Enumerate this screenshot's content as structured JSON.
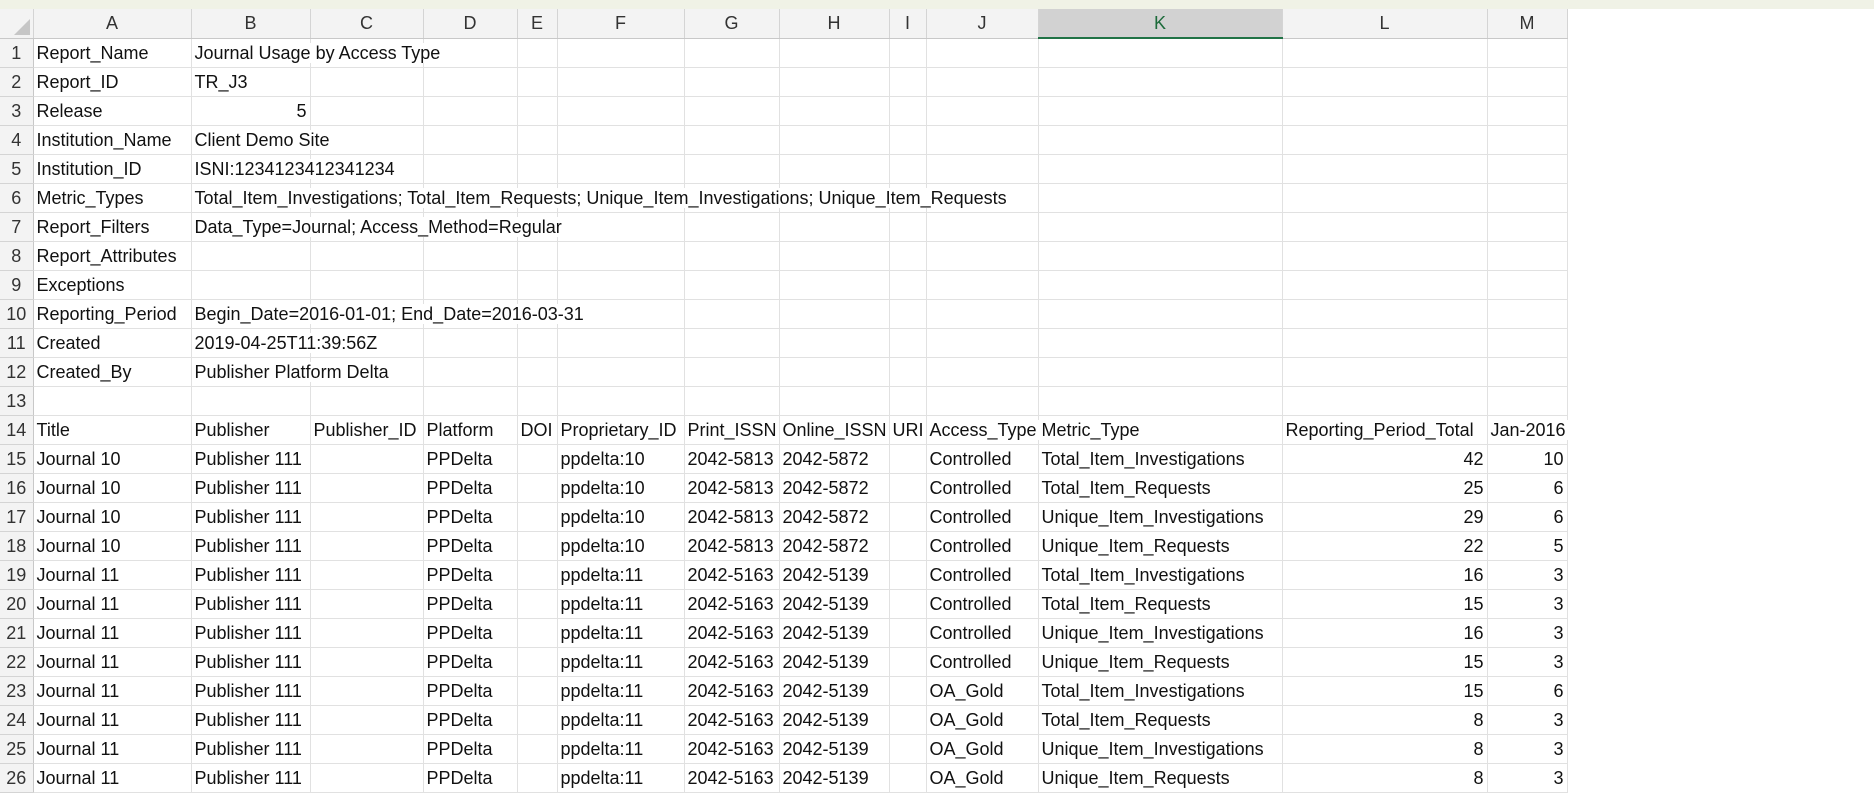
{
  "columns": [
    "A",
    "B",
    "C",
    "D",
    "E",
    "F",
    "G",
    "H",
    "I",
    "J",
    "K",
    "L",
    "M"
  ],
  "selected_column": "K",
  "rows": [
    {
      "num": "1",
      "cells": [
        "Report_Name",
        "Journal Usage by Access Type",
        "",
        "",
        "",
        "",
        "",
        "",
        "",
        "",
        "",
        "",
        ""
      ]
    },
    {
      "num": "2",
      "cells": [
        "Report_ID",
        "TR_J3",
        "",
        "",
        "",
        "",
        "",
        "",
        "",
        "",
        "",
        "",
        ""
      ]
    },
    {
      "num": "3",
      "cells": [
        "Release",
        "5",
        "",
        "",
        "",
        "",
        "",
        "",
        "",
        "",
        "",
        "",
        ""
      ]
    },
    {
      "num": "4",
      "cells": [
        "Institution_Name",
        "Client Demo Site",
        "",
        "",
        "",
        "",
        "",
        "",
        "",
        "",
        "",
        "",
        ""
      ]
    },
    {
      "num": "5",
      "cells": [
        "Institution_ID",
        "ISNI:1234123412341234",
        "",
        "",
        "",
        "",
        "",
        "",
        "",
        "",
        "",
        "",
        ""
      ]
    },
    {
      "num": "6",
      "cells": [
        "Metric_Types",
        "Total_Item_Investigations; Total_Item_Requests; Unique_Item_Investigations; Unique_Item_Requests",
        "",
        "",
        "",
        "",
        "",
        "",
        "",
        "",
        "",
        "",
        ""
      ]
    },
    {
      "num": "7",
      "cells": [
        "Report_Filters",
        "Data_Type=Journal; Access_Method=Regular",
        "",
        "",
        "",
        "",
        "",
        "",
        "",
        "",
        "",
        "",
        ""
      ]
    },
    {
      "num": "8",
      "cells": [
        "Report_Attributes",
        "",
        "",
        "",
        "",
        "",
        "",
        "",
        "",
        "",
        "",
        "",
        ""
      ]
    },
    {
      "num": "9",
      "cells": [
        "Exceptions",
        "",
        "",
        "",
        "",
        "",
        "",
        "",
        "",
        "",
        "",
        "",
        ""
      ]
    },
    {
      "num": "10",
      "cells": [
        "Reporting_Period",
        "Begin_Date=2016-01-01; End_Date=2016-03-31",
        "",
        "",
        "",
        "",
        "",
        "",
        "",
        "",
        "",
        "",
        ""
      ]
    },
    {
      "num": "11",
      "cells": [
        "Created",
        "2019-04-25T11:39:56Z",
        "",
        "",
        "",
        "",
        "",
        "",
        "",
        "",
        "",
        "",
        ""
      ]
    },
    {
      "num": "12",
      "cells": [
        "Created_By",
        "Publisher Platform Delta",
        "",
        "",
        "",
        "",
        "",
        "",
        "",
        "",
        "",
        "",
        ""
      ]
    },
    {
      "num": "13",
      "cells": [
        "",
        "",
        "",
        "",
        "",
        "",
        "",
        "",
        "",
        "",
        "",
        "",
        ""
      ]
    },
    {
      "num": "14",
      "cells": [
        "Title",
        "Publisher",
        "Publisher_ID",
        "Platform",
        "DOI",
        "Proprietary_ID",
        "Print_ISSN",
        "Online_ISSN",
        "URI",
        "Access_Type",
        "Metric_Type",
        "Reporting_Period_Total",
        "Jan-2016"
      ]
    },
    {
      "num": "15",
      "cells": [
        "Journal 10",
        "Publisher 111",
        "",
        "PPDelta",
        "",
        "ppdelta:10",
        "2042-5813",
        "2042-5872",
        "",
        "Controlled",
        "Total_Item_Investigations",
        "42",
        "10"
      ]
    },
    {
      "num": "16",
      "cells": [
        "Journal 10",
        "Publisher 111",
        "",
        "PPDelta",
        "",
        "ppdelta:10",
        "2042-5813",
        "2042-5872",
        "",
        "Controlled",
        "Total_Item_Requests",
        "25",
        "6"
      ]
    },
    {
      "num": "17",
      "cells": [
        "Journal 10",
        "Publisher 111",
        "",
        "PPDelta",
        "",
        "ppdelta:10",
        "2042-5813",
        "2042-5872",
        "",
        "Controlled",
        "Unique_Item_Investigations",
        "29",
        "6"
      ]
    },
    {
      "num": "18",
      "cells": [
        "Journal 10",
        "Publisher 111",
        "",
        "PPDelta",
        "",
        "ppdelta:10",
        "2042-5813",
        "2042-5872",
        "",
        "Controlled",
        "Unique_Item_Requests",
        "22",
        "5"
      ]
    },
    {
      "num": "19",
      "cells": [
        "Journal 11",
        "Publisher 111",
        "",
        "PPDelta",
        "",
        "ppdelta:11",
        "2042-5163",
        "2042-5139",
        "",
        "Controlled",
        "Total_Item_Investigations",
        "16",
        "3"
      ]
    },
    {
      "num": "20",
      "cells": [
        "Journal 11",
        "Publisher 111",
        "",
        "PPDelta",
        "",
        "ppdelta:11",
        "2042-5163",
        "2042-5139",
        "",
        "Controlled",
        "Total_Item_Requests",
        "15",
        "3"
      ]
    },
    {
      "num": "21",
      "cells": [
        "Journal 11",
        "Publisher 111",
        "",
        "PPDelta",
        "",
        "ppdelta:11",
        "2042-5163",
        "2042-5139",
        "",
        "Controlled",
        "Unique_Item_Investigations",
        "16",
        "3"
      ]
    },
    {
      "num": "22",
      "cells": [
        "Journal 11",
        "Publisher 111",
        "",
        "PPDelta",
        "",
        "ppdelta:11",
        "2042-5163",
        "2042-5139",
        "",
        "Controlled",
        "Unique_Item_Requests",
        "15",
        "3"
      ]
    },
    {
      "num": "23",
      "cells": [
        "Journal 11",
        "Publisher 111",
        "",
        "PPDelta",
        "",
        "ppdelta:11",
        "2042-5163",
        "2042-5139",
        "",
        "OA_Gold",
        "Total_Item_Investigations",
        "15",
        "6"
      ]
    },
    {
      "num": "24",
      "cells": [
        "Journal 11",
        "Publisher 111",
        "",
        "PPDelta",
        "",
        "ppdelta:11",
        "2042-5163",
        "2042-5139",
        "",
        "OA_Gold",
        "Total_Item_Requests",
        "8",
        "3"
      ]
    },
    {
      "num": "25",
      "cells": [
        "Journal 11",
        "Publisher 111",
        "",
        "PPDelta",
        "",
        "ppdelta:11",
        "2042-5163",
        "2042-5139",
        "",
        "OA_Gold",
        "Unique_Item_Investigations",
        "8",
        "3"
      ]
    },
    {
      "num": "26",
      "cells": [
        "Journal 11",
        "Publisher 111",
        "",
        "PPDelta",
        "",
        "ppdelta:11",
        "2042-5163",
        "2042-5139",
        "",
        "OA_Gold",
        "Unique_Item_Requests",
        "8",
        "3"
      ]
    }
  ]
}
